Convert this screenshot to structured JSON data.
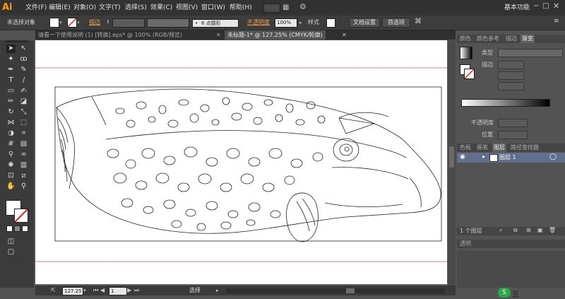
{
  "app": {
    "logo": "Ai",
    "workspace": "基本功能"
  },
  "menu": [
    "文件(F)",
    "编辑(E)",
    "对象(O)",
    "文字(T)",
    "选择(S)",
    "效果(C)",
    "视图(V)",
    "窗口(W)",
    "帮助(H)"
  ],
  "control": {
    "selection": "未选择对象",
    "stroke_label": "描边",
    "brush": "6 点圆形",
    "opacity_label": "不透明度",
    "opacity_value": "100%",
    "style_label": "样式",
    "doc_setup": "文档设置",
    "preferences": "首选项"
  },
  "tabs": [
    {
      "label": "请看一下使用说明 (1) [转换].eps* @ 100% (RGB/预览)",
      "active": false
    },
    {
      "label": "未标题-1* @ 127.25% (CMYK/轮廓)",
      "active": true
    }
  ],
  "status": {
    "zoom": "127.25",
    "page": "1",
    "tool": "选择"
  },
  "panels": {
    "top_tabs": [
      "颜色",
      "颜色参考",
      "描边",
      "渐变"
    ],
    "gradient": {
      "type_label": "类型",
      "stroke_label": "描边",
      "opacity_label": "不透明度",
      "position_label": "位置"
    },
    "layer_tabs": [
      "色板",
      "画笔",
      "图层",
      "路径查找器"
    ],
    "layer_name": "图层 1",
    "layer_count": "1 个图层",
    "transparency_tab": "透明"
  },
  "watermark": "五"
}
